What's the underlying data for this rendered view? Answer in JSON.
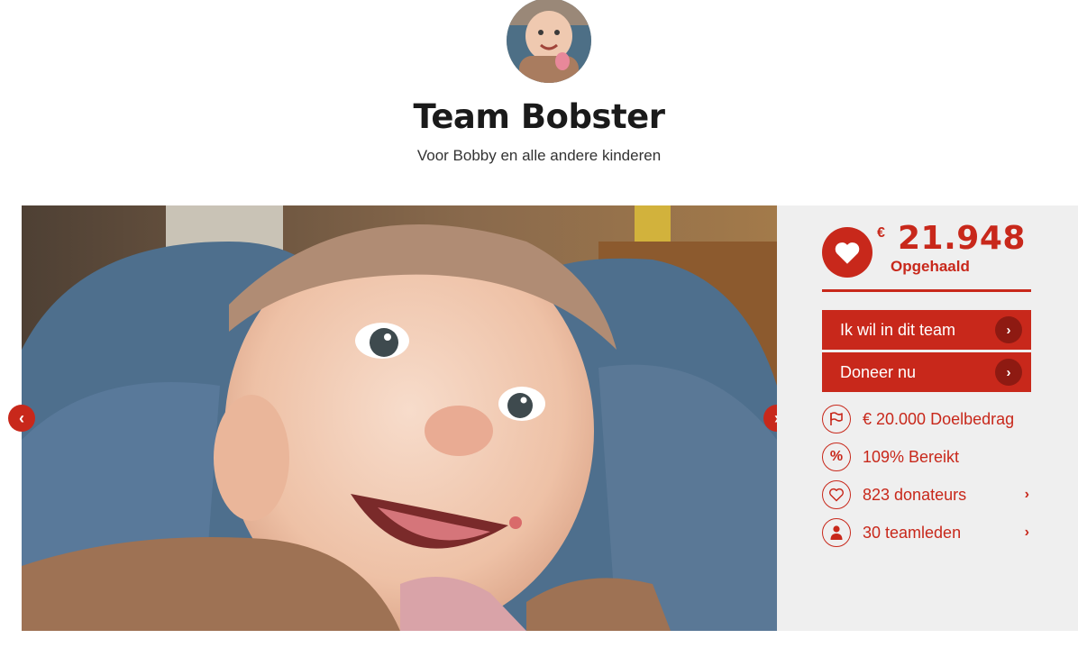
{
  "team": {
    "name": "Team Bobster",
    "tagline": "Voor Bobby en alle andere kinderen"
  },
  "fundraising": {
    "currency_symbol": "€",
    "amount_raised": "21.948",
    "raised_label": "Opgehaald",
    "goal_text": "€ 20.000 Doelbedrag",
    "percent_text": "109% Bereikt",
    "donors_text": "823 donateurs",
    "members_text": "30 teamleden"
  },
  "actions": {
    "join_label": "Ik wil in dit team",
    "donate_label": "Doneer nu"
  },
  "icons": {
    "heart": "heart-icon",
    "flag": "flag-icon",
    "percent": "percent-icon",
    "heart_outline": "heart-outline-icon",
    "person": "person-icon",
    "chevron_left": "chevron-left-icon",
    "chevron_right": "chevron-right-icon"
  },
  "glyphs": {
    "chevron_left": "‹",
    "chevron_right": "›",
    "percent": "%"
  },
  "colors": {
    "accent": "#c8281b",
    "accent_dark": "#8e1a12",
    "panel_bg": "#efefef",
    "title": "#1a1a1a"
  }
}
